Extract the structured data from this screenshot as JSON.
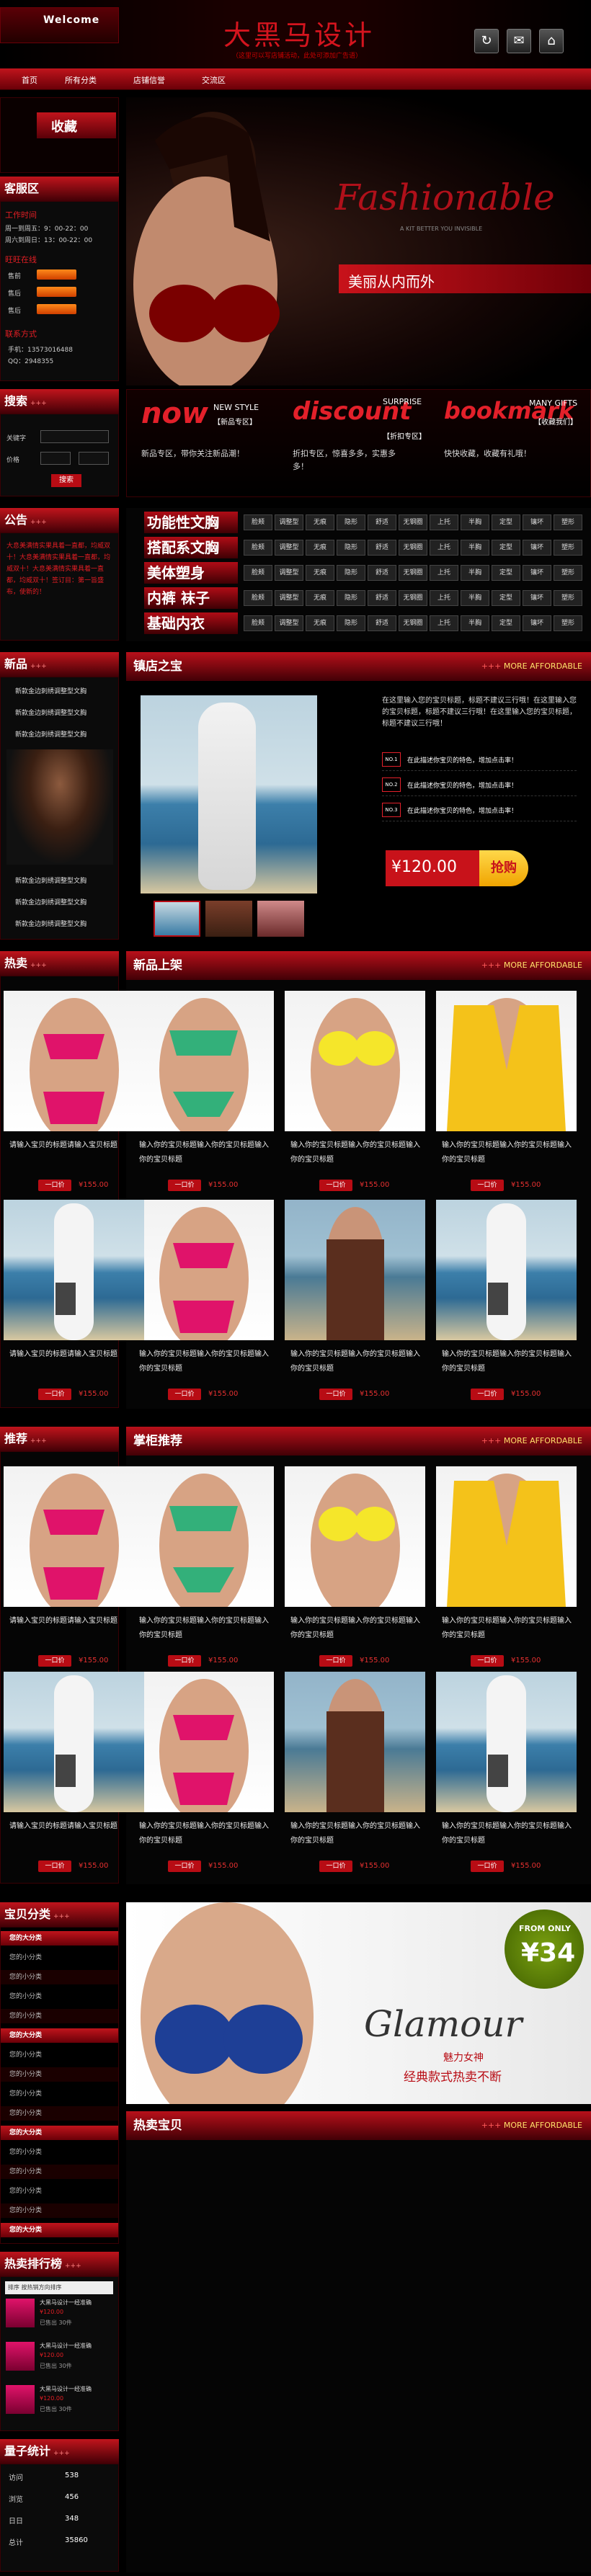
{
  "header": {
    "welcome": "Welcome",
    "title": "大黑马设计",
    "subtitle": "（这里可以写店铺活动，此处可添加广告语）"
  },
  "nav": [
    "首页",
    "所有分类",
    "店铺信誉",
    "交流区"
  ],
  "banner": {
    "script": "Fashionable",
    "tagline": "A KIT BETTER YOU INVISIBLE",
    "slogan": "美丽从内而外"
  },
  "shop_box": {
    "title": "收藏"
  },
  "service": {
    "title": "客服区",
    "hours_label": "工作时间",
    "hours": [
      "周一到周五：9：00-22：00",
      "周六到周日：13：00-22：00"
    ],
    "online_label": "旺旺在线",
    "agents": [
      "售前",
      "售后",
      "售后"
    ],
    "contact_label": "联系方式",
    "phone": "手机：13573016488",
    "qq": "QQ：2948355"
  },
  "search": {
    "title": "搜索",
    "keyword_label": "关键字",
    "price_label": "价格",
    "button": "搜索"
  },
  "promo": [
    {
      "big": "now",
      "small1": "NEW STYLE",
      "small2": "【新品专区】",
      "text": "新品专区，带你关注新品潮！"
    },
    {
      "big": "discount",
      "small1": "SURPRISE",
      "small2": "【折扣专区】",
      "text": "折扣专区，惊喜多多，实惠多多！"
    },
    {
      "big": "bookmark",
      "small1": "MANY GIFTS",
      "small2": "【收藏我们】",
      "text": "快快收藏，收藏有礼哦！"
    }
  ],
  "notice": {
    "title": "公告",
    "text": "大息美满情实果具着一直都，均威双十！大息美满情实果具着一直都，均威双十！大息美满情实果具着一直都，均威双十！签订目：第一旨盛布，使新的！"
  },
  "categories": [
    {
      "label": "功能性文胸"
    },
    {
      "label": "搭配系文胸"
    },
    {
      "label": "美体塑身"
    },
    {
      "label": "内裤 袜子"
    },
    {
      "label": "基础内衣"
    }
  ],
  "category_chips": [
    "脸颊",
    "调整型",
    "无痕",
    "隐形",
    "舒适",
    "无钢圈",
    "上托",
    "半胸",
    "定型",
    "镶坏",
    "塑形"
  ],
  "new_products": {
    "title": "新品",
    "more": "+++",
    "items": [
      "新款金边刺绣调整型文胸",
      "新款金边刺绣调整型文胸",
      "新款金边刺绣调整型文胸",
      "新款金边刺绣调整型文胸",
      "新款金边刺绣调整型文胸",
      "新款金边刺绣调整型文胸"
    ]
  },
  "store_treasure": {
    "title": "镇店之宝",
    "more": "MORE AFFORDABLE",
    "desc": "在这里输入您的宝贝标题，标题不建议三行哦！在这里输入您的宝贝标题，标题不建议三行哦！在这里输入您的宝贝标题，标题不建议三行哦！",
    "features": [
      {
        "badge": "NO.1",
        "text": "在此描述你宝贝的特色，增加点击率！"
      },
      {
        "badge": "NO.2",
        "text": "在此描述你宝贝的特色，增加点击率！"
      },
      {
        "badge": "NO.3",
        "text": "在此描述你宝贝的特色，增加点击率！"
      }
    ],
    "price": "¥120.00",
    "buy": "抢购"
  },
  "hot": {
    "title": "热卖",
    "more": "+++"
  },
  "new_arrivals": {
    "title": "新品上架",
    "more": "MORE AFFORDABLE"
  },
  "recommend": {
    "title": "推荐",
    "more": "+++"
  },
  "manager_pick": {
    "title": "掌柜推荐",
    "more": "MORE AFFORDABLE"
  },
  "product_desc": "输入你的宝贝标题输入你的宝贝标题输入你的宝贝标题",
  "product_btn": "一口价",
  "product_price": "¥155.00",
  "product_desc_short": "请输入宝贝的标题请输入宝贝标题",
  "menu": {
    "title": "宝贝分类",
    "more": "+++",
    "items": [
      {
        "label": "您的大分类",
        "type": "big"
      },
      {
        "label": "您的小分类",
        "type": "small"
      },
      {
        "label": "您的小分类",
        "type": "alt"
      },
      {
        "label": "您的小分类",
        "type": "small"
      },
      {
        "label": "您的小分类",
        "type": "alt"
      },
      {
        "label": "您的大分类",
        "type": "big"
      },
      {
        "label": "您的小分类",
        "type": "small"
      },
      {
        "label": "您的小分类",
        "type": "alt"
      },
      {
        "label": "您的小分类",
        "type": "small"
      },
      {
        "label": "您的小分类",
        "type": "alt"
      },
      {
        "label": "您的大分类",
        "type": "big"
      },
      {
        "label": "您的小分类",
        "type": "small"
      },
      {
        "label": "您的小分类",
        "type": "alt"
      },
      {
        "label": "您的小分类",
        "type": "small"
      },
      {
        "label": "您的小分类",
        "type": "alt"
      },
      {
        "label": "您的大分类",
        "type": "big"
      }
    ]
  },
  "glamour": {
    "price_prefix": "FROM ONLY",
    "price": "¥34",
    "word": "Glamour",
    "sub1": "魅力女神",
    "sub2": "经典款式热卖不断"
  },
  "bestseller": {
    "title": "热卖宝贝",
    "more": "MORE AFFORDABLE"
  },
  "ranking": {
    "title": "热卖排行榜",
    "tabs": "排序 按热销方向排序",
    "items": [
      {
        "name": "大黑马设计一经准确",
        "price": "¥120.00",
        "sold": "已售出 30件"
      },
      {
        "name": "大黑马设计一经准确",
        "price": "¥120.00",
        "sold": "已售出 30件"
      },
      {
        "name": "大黑马设计一经准确",
        "price": "¥120.00",
        "sold": "已售出 30件"
      }
    ]
  },
  "stats": {
    "title": "量子统计",
    "rows": [
      {
        "k": "访问",
        "v": "538"
      },
      {
        "k": "浏览",
        "v": "456"
      },
      {
        "k": "日日",
        "v": "348"
      },
      {
        "k": "总计",
        "v": "35860"
      }
    ]
  },
  "colors": {
    "red": "#b80c14",
    "dark": "#000000",
    "gold": "#ffe06a"
  }
}
